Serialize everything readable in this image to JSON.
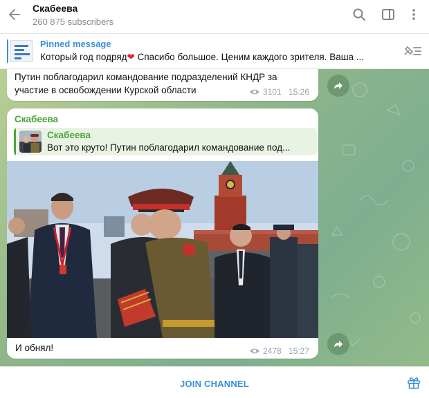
{
  "header": {
    "title": "Скабеева",
    "subscribers": "260 875 subscribers",
    "icons": [
      "back-arrow-icon",
      "search-icon",
      "sidebar-toggle-icon",
      "more-vertical-icon"
    ]
  },
  "pinned": {
    "title": "Pinned message",
    "text_before_heart": "Который год подряд",
    "heart": "❤",
    "text_after_heart": "  Спасибо большое. Ценим каждого зрителя.  Ваша ..."
  },
  "messages": [
    {
      "text": "Путин поблагодарил командование подразделений КНДР за участие в освобождении Курской области",
      "views": "3101",
      "time": "15:26"
    },
    {
      "author": "Скабеева",
      "reply": {
        "author": "Скабеева",
        "text": "Вот это круто!  Путин поблагодарил командование под..."
      },
      "caption": "И обнял!",
      "views": "2478",
      "time": "15:27"
    }
  ],
  "footer": {
    "join_label": "JOIN CHANNEL"
  },
  "colors": {
    "accent_blue": "#3a8fd8",
    "author_green": "#4ba53c",
    "chat_bg": "#8fb68a"
  }
}
